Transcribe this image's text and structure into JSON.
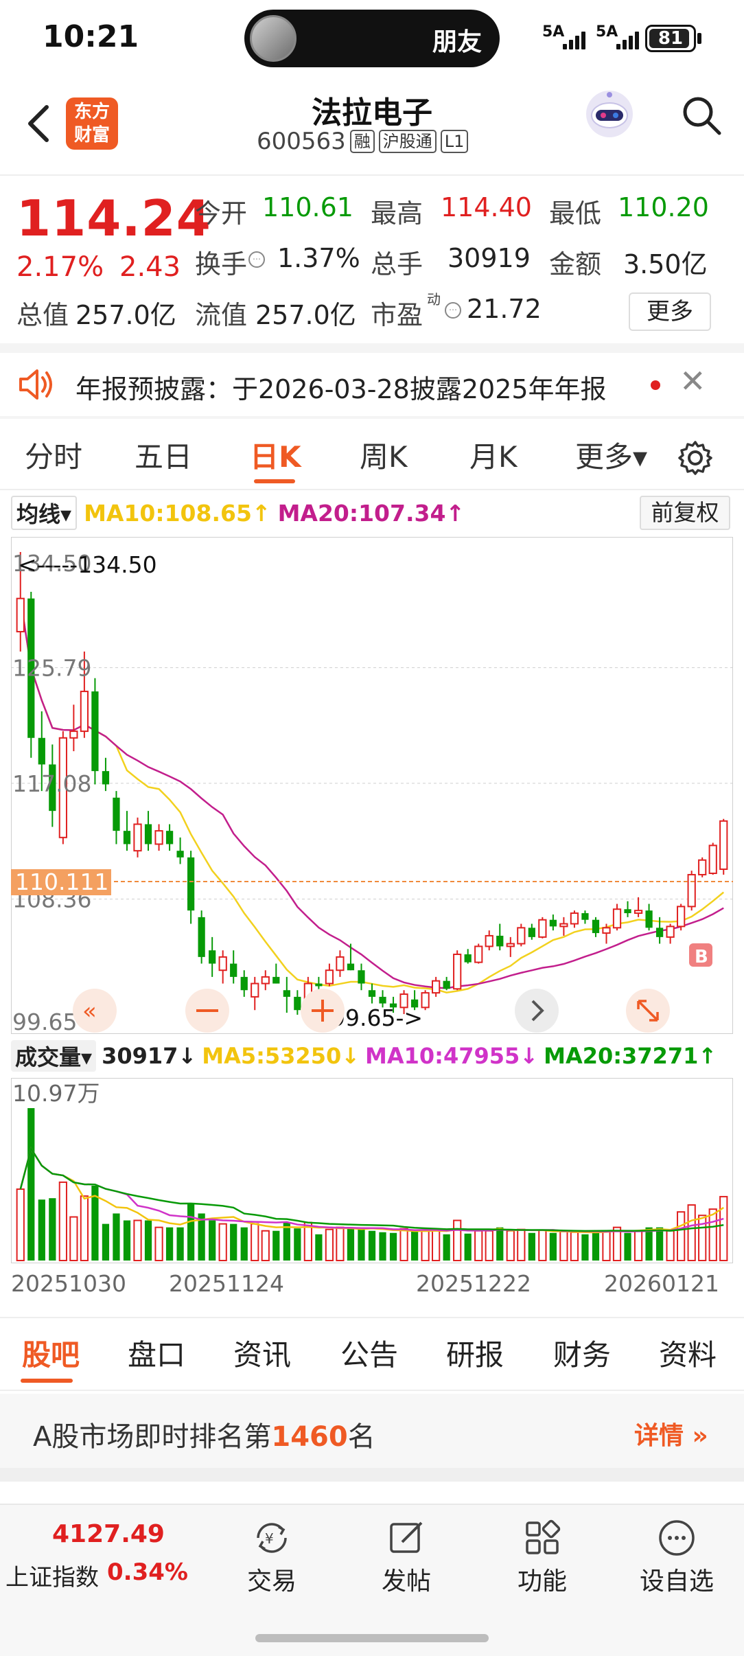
{
  "status_bar": {
    "time": "10:21",
    "island_label": "朋友",
    "signal1": "5A",
    "signal2": "5A",
    "battery": "81"
  },
  "header": {
    "logo_line1": "东方",
    "logo_line2": "财富",
    "stock_name": "法拉电子",
    "stock_code": "600563",
    "tags": [
      "融",
      "沪股通",
      "L1"
    ]
  },
  "quote": {
    "price": "114.24",
    "change_pct": "2.17%",
    "change_amt": "2.43",
    "open_label": "今开",
    "open": "110.61",
    "high_label": "最高",
    "high": "114.40",
    "low_label": "最低",
    "low": "110.20",
    "turnover_label": "换手",
    "turnover": "1.37%",
    "volume_label": "总手",
    "volume": "30919",
    "amount_label": "金额",
    "amount": "3.50亿",
    "mktcap_label": "总值",
    "mktcap": "257.0亿",
    "float_label": "流值",
    "float_cap": "257.0亿",
    "pe_label": "市盈",
    "pe_sup": "动",
    "pe": "21.72",
    "more_label": "更多"
  },
  "announcement": {
    "text": "年报预披露：于2026-03-28披露2025年年报"
  },
  "period_tabs": [
    {
      "label": "分时"
    },
    {
      "label": "五日"
    },
    {
      "label": "日K"
    },
    {
      "label": "周K"
    },
    {
      "label": "月K"
    },
    {
      "label": "更多▾"
    }
  ],
  "ma_legend": {
    "select": "均线▾",
    "ma10": "MA10:108.65↑",
    "ma20": "MA20:107.34↑",
    "adjust": "前复权"
  },
  "volume_legend": {
    "select": "成交量▾",
    "vol": "30917↓",
    "ma5": "MA5:53250↓",
    "ma10": "MA10:47955↓",
    "ma20": "MA20:37271↑"
  },
  "colors": {
    "up": "#e02020",
    "down": "#079a07",
    "accent": "#ef5a24",
    "ma5": "#f2d11e",
    "ma10": "#f2d11e",
    "ma20": "#c21e8c"
  },
  "chart_data": {
    "type": "candlestick",
    "y_labels": [
      "134.50",
      "125.79",
      "117.08",
      "108.36",
      "99.65"
    ],
    "ylim": [
      99.65,
      134.5
    ],
    "annotations": {
      "max": "<-----134.50",
      "min": "99.65->",
      "current": "110.111",
      "buy_marker": "B"
    },
    "dates": [
      "20251030",
      "20251124",
      "20251222",
      "20260121"
    ],
    "candles": [
      [
        128.5,
        134.5,
        127.0,
        131.0
      ],
      [
        131.0,
        131.5,
        119.0,
        120.5
      ],
      [
        120.5,
        122.5,
        116.5,
        118.5
      ],
      [
        118.5,
        120.0,
        113.8,
        115.0
      ],
      [
        113.0,
        121.0,
        112.5,
        120.5
      ],
      [
        120.5,
        123.0,
        119.5,
        121.0
      ],
      [
        121.0,
        127.0,
        120.5,
        124.0
      ],
      [
        124.0,
        125.0,
        117.0,
        118.0
      ],
      [
        118.0,
        119.0,
        116.5,
        117.0
      ],
      [
        116.0,
        116.5,
        112.5,
        113.5
      ],
      [
        113.5,
        115.0,
        112.0,
        112.5
      ],
      [
        112.0,
        114.5,
        111.5,
        114.0
      ],
      [
        114.0,
        115.0,
        112.0,
        112.5
      ],
      [
        112.5,
        114.0,
        112.0,
        113.5
      ],
      [
        113.5,
        114.0,
        112.0,
        112.5
      ],
      [
        112.0,
        113.0,
        111.0,
        111.5
      ],
      [
        111.5,
        112.0,
        106.5,
        107.5
      ],
      [
        107.0,
        107.5,
        103.5,
        104.0
      ],
      [
        104.5,
        105.5,
        102.5,
        103.5
      ],
      [
        103.0,
        104.5,
        102.0,
        104.0
      ],
      [
        103.5,
        104.5,
        102.0,
        102.5
      ],
      [
        102.5,
        103.0,
        101.0,
        101.5
      ],
      [
        101.0,
        102.5,
        100.0,
        102.0
      ],
      [
        102.0,
        103.0,
        101.5,
        102.5
      ],
      [
        102.5,
        103.5,
        102.0,
        102.0
      ],
      [
        101.5,
        102.5,
        99.8,
        101.0
      ],
      [
        101.0,
        101.5,
        99.65,
        100.0
      ],
      [
        100.0,
        102.5,
        99.8,
        102.0
      ],
      [
        102.0,
        102.5,
        101.5,
        101.8
      ],
      [
        102.0,
        103.5,
        101.8,
        103.0
      ],
      [
        103.0,
        104.5,
        102.5,
        104.0
      ],
      [
        103.5,
        105.0,
        103.0,
        103.0
      ],
      [
        103.0,
        103.5,
        101.5,
        102.0
      ],
      [
        101.5,
        102.0,
        100.5,
        101.0
      ],
      [
        101.0,
        101.5,
        100.2,
        100.5
      ],
      [
        100.5,
        101.0,
        99.8,
        100.2
      ],
      [
        100.2,
        101.5,
        99.7,
        101.2
      ],
      [
        100.8,
        101.5,
        100.0,
        100.2
      ],
      [
        100.2,
        101.5,
        100.0,
        101.3
      ],
      [
        101.3,
        102.5,
        101.0,
        102.2
      ],
      [
        102.2,
        102.5,
        101.5,
        101.6
      ],
      [
        101.6,
        104.5,
        101.5,
        104.2
      ],
      [
        104.2,
        104.6,
        103.5,
        103.6
      ],
      [
        103.6,
        105.0,
        103.5,
        104.8
      ],
      [
        104.8,
        106.0,
        104.5,
        105.6
      ],
      [
        105.6,
        106.5,
        104.5,
        104.8
      ],
      [
        104.8,
        105.5,
        104.0,
        105.0
      ],
      [
        105.0,
        106.5,
        104.8,
        106.2
      ],
      [
        106.2,
        106.5,
        105.3,
        105.5
      ],
      [
        105.5,
        107.0,
        105.4,
        106.8
      ],
      [
        106.8,
        107.2,
        106.0,
        106.3
      ],
      [
        106.3,
        107.0,
        105.6,
        106.5
      ],
      [
        106.5,
        107.5,
        106.2,
        107.3
      ],
      [
        107.3,
        107.5,
        106.5,
        106.8
      ],
      [
        106.8,
        107.0,
        105.5,
        105.8
      ],
      [
        105.8,
        106.5,
        105.0,
        106.2
      ],
      [
        106.2,
        108.0,
        106.0,
        107.6
      ],
      [
        107.6,
        108.2,
        107.0,
        107.3
      ],
      [
        107.3,
        108.5,
        107.0,
        107.5
      ],
      [
        107.5,
        108.0,
        106.0,
        106.2
      ],
      [
        106.2,
        107.0,
        105.0,
        105.5
      ],
      [
        105.5,
        106.5,
        105.0,
        106.3
      ],
      [
        106.3,
        108.0,
        106.0,
        107.8
      ],
      [
        107.8,
        110.5,
        107.5,
        110.2
      ],
      [
        110.2,
        111.5,
        110.0,
        111.3
      ],
      [
        110.3,
        112.6,
        110.2,
        112.4
      ],
      [
        110.61,
        114.4,
        110.2,
        114.24
      ]
    ],
    "volume": {
      "max_label": "10.97万",
      "current": "30917"
    }
  },
  "content_tabs": [
    {
      "label": "股吧"
    },
    {
      "label": "盘口"
    },
    {
      "label": "资讯"
    },
    {
      "label": "公告"
    },
    {
      "label": "研报"
    },
    {
      "label": "财务"
    },
    {
      "label": "资料"
    }
  ],
  "rank": {
    "prefix": "A股市场即时排名第",
    "number": "1460",
    "suffix": "名",
    "detail": "详情 »"
  },
  "toolbar": {
    "index_value": "4127.49",
    "index_name": "上证指数",
    "index_pct": "0.34%",
    "items": [
      {
        "label": "交易",
        "icon": "trade-icon"
      },
      {
        "label": "发帖",
        "icon": "post-icon"
      },
      {
        "label": "功能",
        "icon": "function-icon"
      },
      {
        "label": "设自选",
        "icon": "add-watchlist-icon"
      }
    ]
  }
}
